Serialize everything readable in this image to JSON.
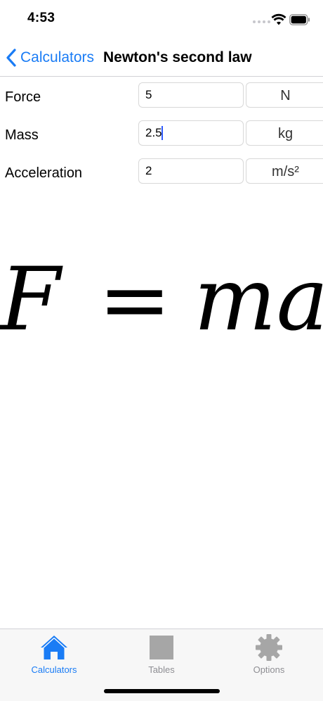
{
  "status_bar": {
    "time": "4:53"
  },
  "nav": {
    "back_label": "Calculators",
    "title": "Newton's second law"
  },
  "fields": [
    {
      "label": "Force",
      "value": "5",
      "unit": "N"
    },
    {
      "label": "Mass",
      "value": "2.5",
      "unit": "kg"
    },
    {
      "label": "Acceleration",
      "value": "2",
      "unit": "m/s²"
    }
  ],
  "formula": {
    "lhs": "F",
    "op": "=",
    "rhs": "ma"
  },
  "tabs": [
    {
      "label": "Calculators",
      "icon": "house-icon",
      "active": true
    },
    {
      "label": "Tables",
      "icon": "square-icon",
      "active": false
    },
    {
      "label": "Options",
      "icon": "gear-icon",
      "active": false
    }
  ],
  "colors": {
    "accent": "#1a7cf5",
    "inactive": "#8e8e93",
    "caret": "#2f5bff"
  }
}
